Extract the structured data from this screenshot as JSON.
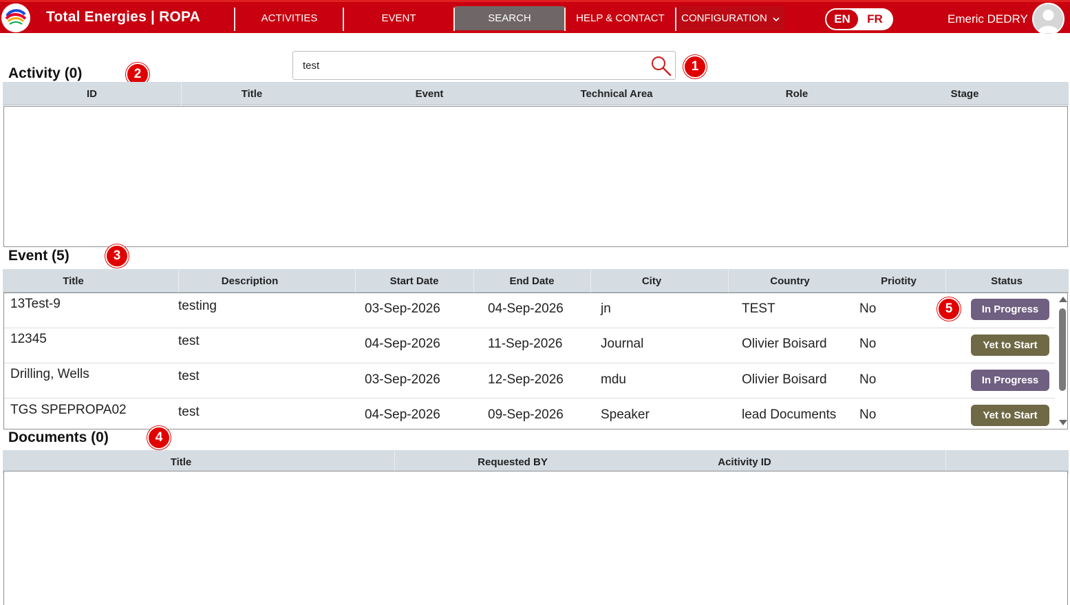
{
  "header": {
    "app_title": "Total Energies | ROPA",
    "nav": [
      {
        "label": "ACTIVITIES"
      },
      {
        "label": "EVENT"
      },
      {
        "label": "SEARCH",
        "active": true
      },
      {
        "label": "HELP & CONTACT"
      },
      {
        "label": "CONFIGURATION",
        "icon": "chevron-down-icon"
      }
    ],
    "lang": {
      "en": "EN",
      "fr": "FR",
      "selected": "EN"
    },
    "user_name": "Emeric DEDRY",
    "avatar_icon": "user-avatar-icon"
  },
  "search": {
    "value": "test",
    "icon": "search-icon"
  },
  "markers": [
    "1",
    "2",
    "3",
    "4",
    "5"
  ],
  "activity": {
    "title": "Activity (0)",
    "columns": [
      "ID",
      "Title",
      "Event",
      "Technical Area",
      "Role",
      "Stage"
    ],
    "rows": []
  },
  "event": {
    "title": "Event (5)",
    "columns": [
      "Title",
      "Description",
      "Start Date",
      "End Date",
      "City",
      "Country",
      "Priotity",
      "Status"
    ],
    "rows": [
      {
        "title": "13Test-9",
        "description": "testing",
        "start": "03-Sep-2026",
        "end": "04-Sep-2026",
        "city": "jn",
        "country": "TEST",
        "priority": "No",
        "status": "In Progress"
      },
      {
        "title": "12345",
        "description": "test",
        "start": "04-Sep-2026",
        "end": "11-Sep-2026",
        "city": "Journal",
        "country": "Olivier Boisard",
        "priority": "No",
        "status": "Yet to Start"
      },
      {
        "title": "Drilling, Wells",
        "description": "test",
        "start": "03-Sep-2026",
        "end": "12-Sep-2026",
        "city": "mdu",
        "country": "Olivier Boisard",
        "priority": "No",
        "status": "In Progress"
      },
      {
        "title": "TGS SPEPROPA02",
        "description": "test",
        "start": "04-Sep-2026",
        "end": "09-Sep-2026",
        "city": "Speaker",
        "country": "lead Documents",
        "priority": "No",
        "status": "Yet to Start"
      }
    ]
  },
  "documents": {
    "title": "Documents (0)",
    "columns": [
      "Title",
      "Requested BY",
      "Acitivity ID"
    ],
    "rows": []
  },
  "colors": {
    "brand_red": "#c8000f",
    "nav_active": "#6f6767",
    "status_in_progress": "#6f5f80",
    "status_yet_to_start": "#6f6946",
    "marker_red": "#e00000"
  }
}
